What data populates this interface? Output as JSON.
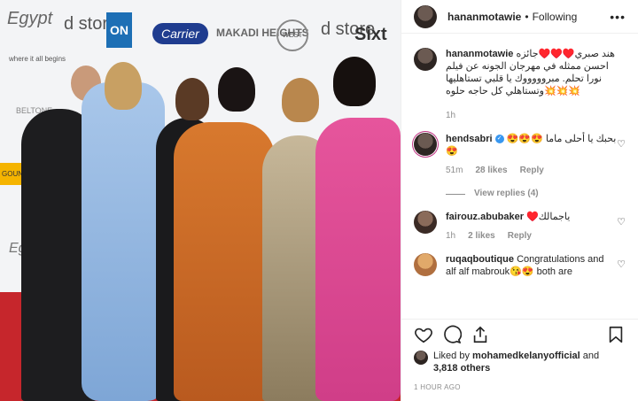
{
  "post": {
    "author": "hananmotawie",
    "follow_status": "Following",
    "separator": "•",
    "more": "•••",
    "caption": "هند صبري♥️♥️♥️جائزه احسن ممثله في مهرجان الجونه عن فيلم نورا تحلم. مبروووووك يا قلبي تستاهليها وتستاهلي كل حاجه حلوه💥💥💥",
    "caption_time": "1h"
  },
  "photo": {
    "logos": [
      "Egypt",
      "where it all begins",
      "d store",
      "ON",
      "Carrier",
      "MAKADI HEIGHTS",
      "WEST",
      "d store",
      "Sixt",
      "BELTONE",
      "GOUNA",
      "Egypt"
    ]
  },
  "comments": [
    {
      "user": "hendsabri",
      "verified": true,
      "text": "بحبك يا أحلى ماما 😍😍😍😍",
      "time": "51m",
      "likes": "28 likes",
      "reply": "Reply",
      "view_replies": "View replies (4)"
    },
    {
      "user": "fairouz.abubaker",
      "verified": false,
      "text": "ياجمالك♥️",
      "time": "1h",
      "likes": "2 likes",
      "reply": "Reply"
    },
    {
      "user": "ruqaqboutique",
      "verified": false,
      "text": "Congratulations and alf alf mabrouk😘😍 both are"
    }
  ],
  "likes": {
    "prefix": "Liked by",
    "user": "mohamedkelanyofficial",
    "and": "and",
    "others": "3,818 others"
  },
  "time_ago": "1 HOUR AGO",
  "colors": {
    "accent": "#3897f0",
    "muted": "#8e8e8e",
    "text": "#262626",
    "carpet": "#c6262c"
  },
  "icons": [
    "heart-icon",
    "comment-icon",
    "share-icon",
    "bookmark-icon",
    "more-icon"
  ]
}
